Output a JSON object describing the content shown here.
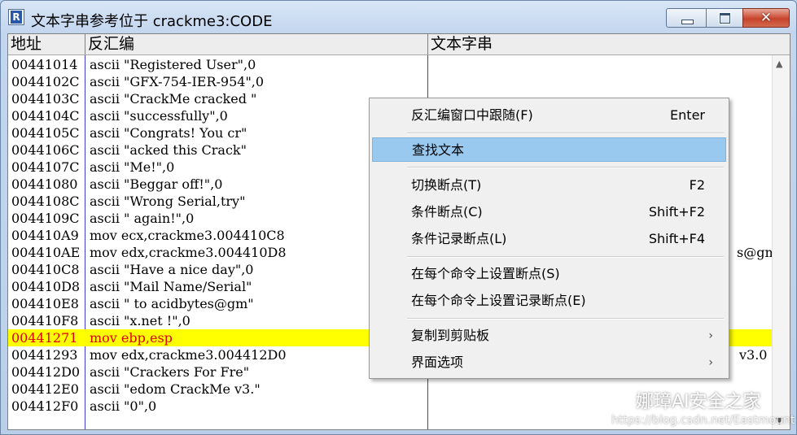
{
  "window": {
    "icon_letter": "R",
    "title": "文本字串参考位于 crackme3:CODE",
    "close_glyph": "✕"
  },
  "columns": {
    "address": "地址",
    "disassembly": "反汇编",
    "text_string": "文本字串"
  },
  "rows": [
    {
      "addr": "00441014",
      "dis": "ascii \"Registered User\",0",
      "txt": ""
    },
    {
      "addr": "0044102C",
      "dis": "ascii \"GFX-754-IER-954\",0",
      "txt": ""
    },
    {
      "addr": "0044103C",
      "dis": "ascii \"CrackMe cracked \"",
      "txt": ""
    },
    {
      "addr": "0044104C",
      "dis": "ascii \"successfully\",0",
      "txt": ""
    },
    {
      "addr": "0044105C",
      "dis": "ascii \"Congrats! You cr\"",
      "txt": ""
    },
    {
      "addr": "0044106C",
      "dis": "ascii \"acked this Crack\"",
      "txt": ""
    },
    {
      "addr": "0044107C",
      "dis": "ascii \"Me!\",0",
      "txt": ""
    },
    {
      "addr": "00441080",
      "dis": "ascii \"Beggar off!\",0",
      "txt": ""
    },
    {
      "addr": "0044108C",
      "dis": "ascii \"Wrong Serial,try\"",
      "txt": ""
    },
    {
      "addr": "0044109C",
      "dis": "ascii \" again!\",0",
      "txt": ""
    },
    {
      "addr": "004410A9",
      "dis": "mov ecx,crackme3.004410C8",
      "txt": ""
    },
    {
      "addr": "004410AE",
      "dis": "mov edx,crackme3.004410D8",
      "txt": "s@gmx"
    },
    {
      "addr": "004410C8",
      "dis": "ascii \"Have a nice day\",0",
      "txt": ""
    },
    {
      "addr": "004410D8",
      "dis": "ascii \"Mail Name/Serial\"",
      "txt": ""
    },
    {
      "addr": "004410E8",
      "dis": "ascii \" to acidbytes@gm\"",
      "txt": ""
    },
    {
      "addr": "004410F8",
      "dis": "ascii \"x.net !\",0",
      "txt": ""
    },
    {
      "addr": "00441271",
      "dis": "mov ebp,esp",
      "txt": "",
      "selected": true
    },
    {
      "addr": "00441293",
      "dis": "mov edx,crackme3.004412D0",
      "txt": "v3.0"
    },
    {
      "addr": "004412D0",
      "dis": "ascii \"Crackers For Fre\"",
      "txt": ""
    },
    {
      "addr": "004412E0",
      "dis": "ascii \"edom CrackMe v3.\"",
      "txt": ""
    },
    {
      "addr": "004412F0",
      "dis": "ascii \"0\",0",
      "txt": ""
    }
  ],
  "context_menu": {
    "items": [
      {
        "label": "反汇编窗口中跟随(F)",
        "shortcut": "Enter"
      },
      {
        "label": "查找文本",
        "shortcut": ""
      },
      {
        "label": "切换断点(T)",
        "shortcut": "F2"
      },
      {
        "label": "条件断点(C)",
        "shortcut": "Shift+F2"
      },
      {
        "label": "条件记录断点(L)",
        "shortcut": "Shift+F4"
      },
      {
        "label": "在每个命令上设置断点(S)",
        "shortcut": ""
      },
      {
        "label": "在每个命令上设置记录断点(E)",
        "shortcut": ""
      },
      {
        "label": "复制到剪贴板",
        "shortcut": "",
        "submenu": true
      },
      {
        "label": "界面选项",
        "shortcut": "",
        "submenu": true
      }
    ],
    "highlighted_index": 1,
    "submenu_arrow": "›"
  },
  "watermark": {
    "name": "娜璋AI安全之家",
    "url": "https://blog.csdn.net/Eastmount"
  },
  "colors": {
    "selected_row_bg": "#ffff00",
    "selected_row_text": "#e00000",
    "menu_highlight": "#99c9ef",
    "column_divider": "#3c3cd2"
  }
}
